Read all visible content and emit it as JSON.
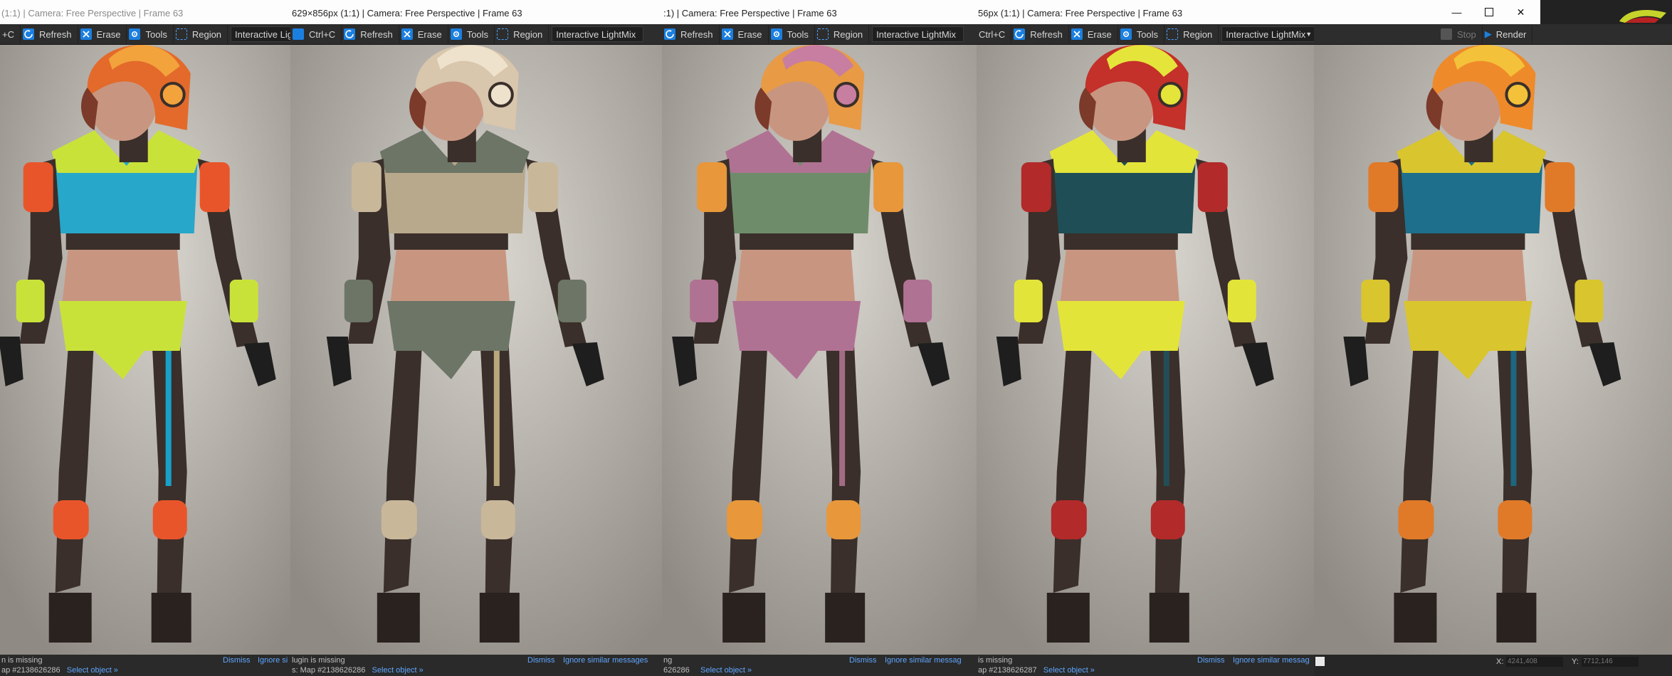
{
  "panels": [
    {
      "title": "(1:1) | Camera: Free Perspective | Frame 63",
      "toolbar": [
        "+C",
        "Refresh",
        "Erase",
        "Tools",
        "Region",
        "Interactive Ligh"
      ],
      "status_line1": "n is missing",
      "status_line2a": "ap #2138626286",
      "status_link": "Select object »",
      "status_dismiss": "Dismiss",
      "status_ignore": "Ignore si",
      "palette": {
        "helmet": "#e36a2a",
        "helmet2": "#f2a33c",
        "top": "#27a7c9",
        "armor": "#c9e23a",
        "accent": "#e9552a",
        "stripe": "#1aa0c8"
      }
    },
    {
      "title": "629×856px (1:1) | Camera: Free Perspective | Frame 63",
      "toolbar": [
        "Ctrl+C",
        "Refresh",
        "Erase",
        "Tools",
        "Region",
        "Interactive LightMix"
      ],
      "status_line1": "lugin is missing",
      "status_line2a": "s: Map #2138626286",
      "status_link": "Select object »",
      "status_dismiss": "Dismiss",
      "status_ignore": "Ignore similar messages",
      "palette": {
        "helmet": "#d8c6ad",
        "helmet2": "#efe2cc",
        "top": "#b8a98c",
        "armor": "#6c7566",
        "accent": "#c9b79a",
        "stripe": "#b9a77e"
      }
    },
    {
      "title": ":1) | Camera: Free Perspective | Frame 63",
      "toolbar": [
        "",
        "Refresh",
        "Erase",
        "Tools",
        "Region",
        "Interactive LightMix"
      ],
      "status_line1": "ng",
      "status_line2a": "626286",
      "status_link": "Select object »",
      "status_dismiss": "Dismiss",
      "status_ignore": "Ignore similar messag",
      "palette": {
        "helmet": "#e89a45",
        "helmet2": "#c77ea0",
        "top": "#6f8c6a",
        "armor": "#b07293",
        "accent": "#e8973a",
        "stripe": "#a46b86"
      }
    },
    {
      "title": "56px (1:1) | Camera: Free Perspective | Frame 63",
      "toolbar": [
        "Ctrl+C",
        "Refresh",
        "Erase",
        "Tools",
        "Region",
        "Interactive LightMix"
      ],
      "status_line1": "is missing",
      "status_line2a": "ap #2138626287",
      "status_link": "Select object »",
      "status_dismiss": "Dismiss",
      "status_ignore": "Ignore similar messag",
      "palette": {
        "helmet": "#c4302a",
        "helmet2": "#e5e43a",
        "top": "#1f4e56",
        "armor": "#e3e43a",
        "accent": "#b22a2a",
        "stripe": "#234e58"
      }
    },
    {
      "title": "",
      "toolbar": [],
      "status_line1": "",
      "status_line2a": "",
      "status_link": "",
      "status_dismiss": "",
      "status_ignore": "",
      "palette": {
        "helmet": "#ef8a2a",
        "helmet2": "#f3c23a",
        "top": "#1d6f8c",
        "armor": "#d9c52e",
        "accent": "#e07a28",
        "stripe": "#1e6680"
      }
    }
  ],
  "render_button": "Render",
  "stop_button": "Stop",
  "coords": {
    "x_label": "X:",
    "x_value": "4241,408",
    "y_label": "Y:",
    "y_value": "7712,146"
  },
  "window_controls": [
    "minimize-icon",
    "maximize-icon",
    "close-icon"
  ],
  "accent_blue": "#1b7fe0"
}
